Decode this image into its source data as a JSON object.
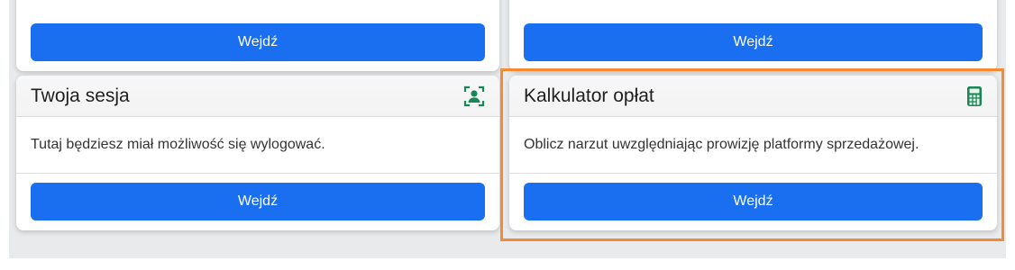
{
  "top_row": {
    "left_button": "Wejdź",
    "right_button": "Wejdź"
  },
  "cards": [
    {
      "title": "Twoja sesja",
      "icon": "person-badge-icon",
      "icon_color": "#198754",
      "description": "Tutaj będziesz miał możliwość się wylogować.",
      "button": "Wejdź"
    },
    {
      "title": "Kalkulator opłat",
      "icon": "calculator-icon",
      "icon_color": "#198754",
      "description": "Oblicz narzut uwzględniając prowizję platformy sprzedażowej.",
      "button": "Wejdź"
    }
  ],
  "colors": {
    "accent": "#1a6ff0",
    "highlight": "#f58a33",
    "icon_green": "#198754"
  }
}
